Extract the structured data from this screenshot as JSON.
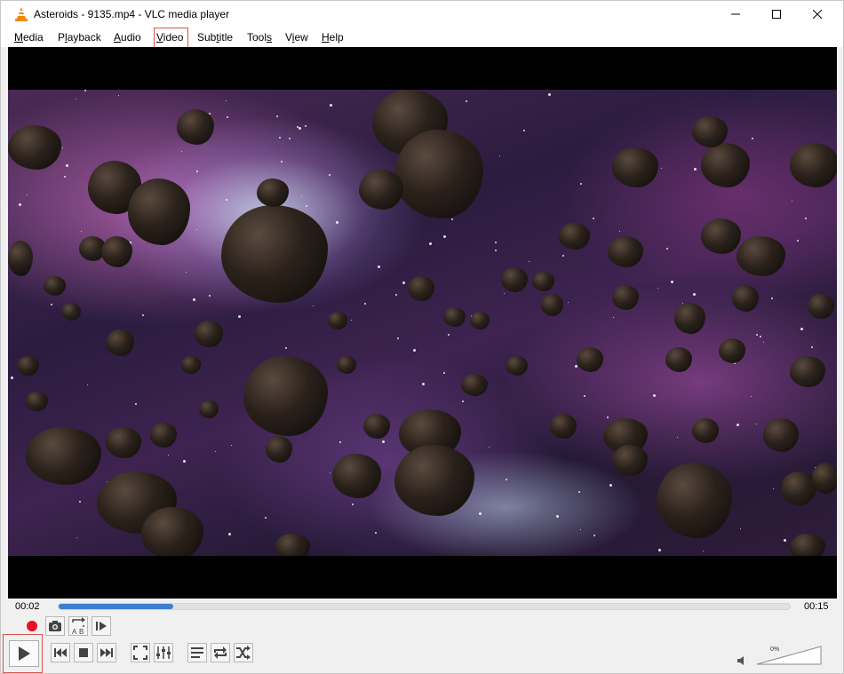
{
  "window": {
    "title": "Asteroids - 9135.mp4 - VLC media player"
  },
  "menu": {
    "items": [
      {
        "label": "Media",
        "accel": "M"
      },
      {
        "label": "Playback",
        "accel": "l"
      },
      {
        "label": "Audio",
        "accel": "A"
      },
      {
        "label": "Video",
        "accel": "V"
      },
      {
        "label": "Subtitle",
        "accel": "t"
      },
      {
        "label": "Tools",
        "accel": "s"
      },
      {
        "label": "View",
        "accel": "i"
      },
      {
        "label": "Help",
        "accel": "H"
      }
    ],
    "highlighted": "Video"
  },
  "playback": {
    "elapsed": "00:02",
    "total": "00:15",
    "progress_fraction": 0.157
  },
  "volume": {
    "label": "0%",
    "level_fraction": 0.0
  },
  "colors": {
    "seek_fill": "#3c7fd1",
    "record_red": "#e81123",
    "highlight_box": "#d9534f",
    "vlc_orange": "#f08a00"
  },
  "icons": {
    "advanced_row": [
      "record-icon",
      "snapshot-icon",
      "loop-ab-icon",
      "frame-step-icon"
    ],
    "main_row": [
      "play-icon",
      "previous-icon",
      "stop-icon",
      "next-icon",
      "fullscreen-icon",
      "extended-settings-icon",
      "playlist-icon",
      "loop-icon",
      "shuffle-icon"
    ]
  }
}
